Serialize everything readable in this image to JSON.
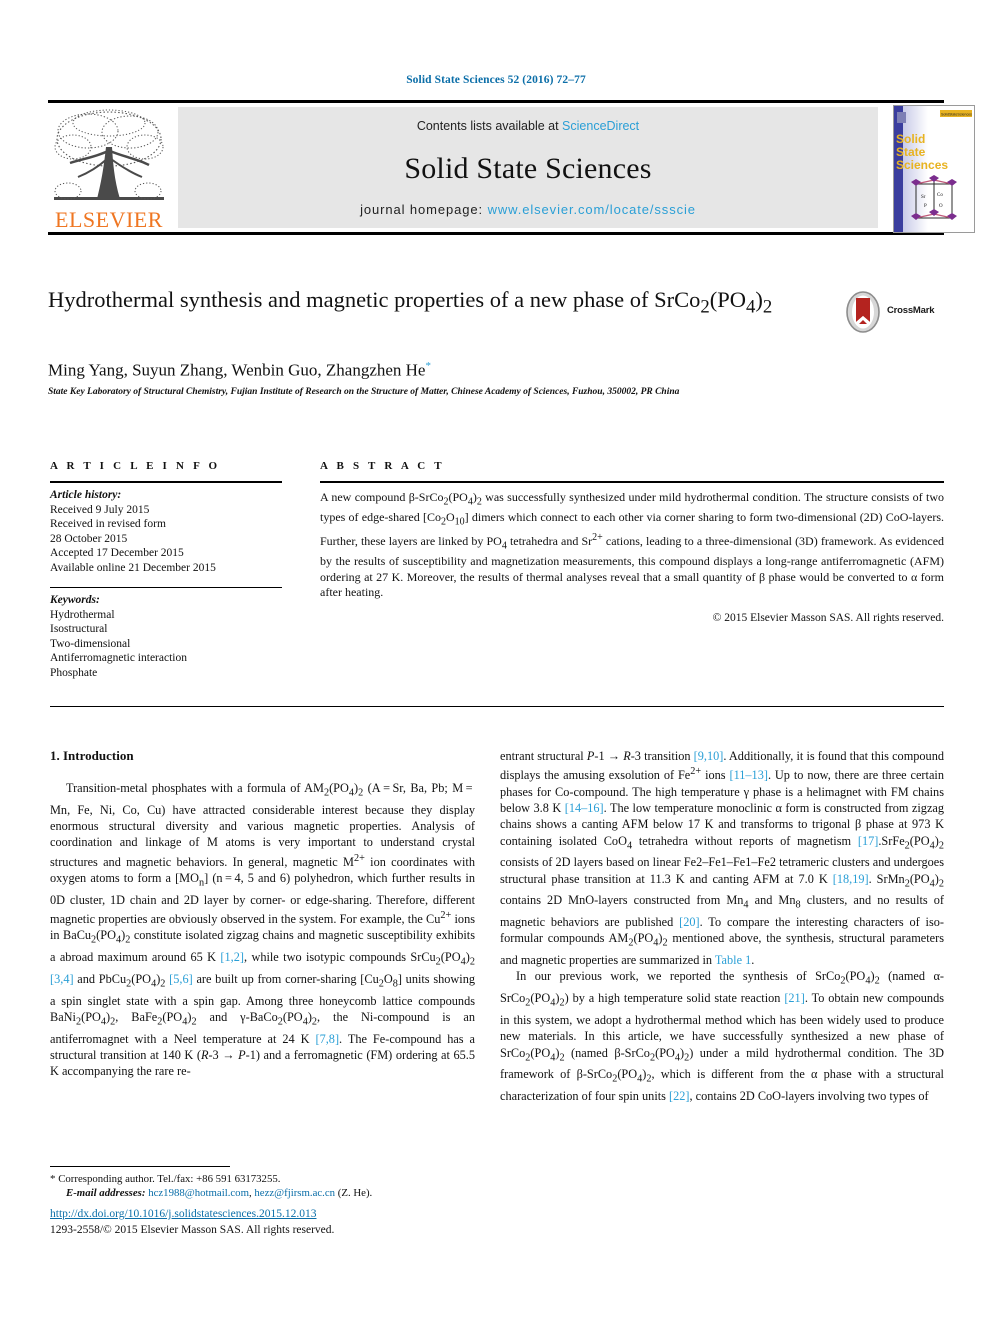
{
  "header": {
    "citation": "Solid State Sciences 52 (2016) 72–77",
    "contents_prefix": "Contents lists available at ",
    "contents_link": "ScienceDirect",
    "journal_name": "Solid State Sciences",
    "homepage_prefix": "journal homepage: ",
    "homepage_url": "www.elsevier.com/locate/ssscie",
    "publisher_wordmark": "ELSEVIER",
    "publisher_logo_icon": "elsevier-tree-icon",
    "cover_title_lines": [
      "Solid",
      "State",
      "Sciences"
    ],
    "cover_badge": "SolidStateSciences",
    "accent_link_color": "#2a9fd6",
    "citation_color": "#0b6ea8",
    "elsevier_orange": "#ef7622"
  },
  "article": {
    "title": "Hydrothermal synthesis and magnetic properties of a new phase of SrCo2(PO4)2",
    "authors": "Ming Yang, Suyun Zhang, Wenbin Guo, Zhangzhen He",
    "corresponding_marker": "*",
    "affiliation": "State Key Laboratory of Structural Chemistry, Fujian Institute of Research on the Structure of Matter, Chinese Academy of Sciences, Fuzhou, 350002, PR China",
    "crossmark_label": "CrossMark",
    "crossmark_icon": "crossmark-icon"
  },
  "article_info": {
    "heading": "A R T I C L E   I N F O",
    "history_label": "Article history:",
    "history_lines": [
      "Received 9 July 2015",
      "Received in revised form",
      "28 October 2015",
      "Accepted 17 December 2015",
      "Available online 21 December 2015"
    ],
    "keywords_label": "Keywords:",
    "keywords": [
      "Hydrothermal",
      "Isostructural",
      "Two-dimensional",
      "Antiferromagnetic interaction",
      "Phosphate"
    ]
  },
  "abstract": {
    "heading": "A B S T R A C T",
    "text": "A new compound β-SrCo2(PO4)2 was successfully synthesized under mild hydrothermal condition. The structure consists of two types of edge-shared [Co2O10] dimers which connect to each other via corner sharing to form two-dimensional (2D) CoO-layers. Further, these layers are linked by PO4 tetrahedra and Sr2+ cations, leading to a three-dimensional (3D) framework. As evidenced by the results of susceptibility and magnetization measurements, this compound displays a long-range antiferromagnetic (AFM) ordering at 27 K. Moreover, the results of thermal analyses reveal that a small quantity of β phase would be converted to α form after heating.",
    "copyright": "© 2015 Elsevier Masson SAS. All rights reserved."
  },
  "body": {
    "section_heading": "1. Introduction",
    "left_paragraph_1": "Transition-metal phosphates with a formula of AM2(PO4)2 (A = Sr, Ba, Pb; M = Mn, Fe, Ni, Co, Cu) have attracted considerable interest because they display enormous structural diversity and various magnetic properties. Analysis of coordination and linkage of M atoms is very important to understand crystal structures and magnetic behaviors. In general, magnetic M2+ ion coordinates with oxygen atoms to form a [MOn] (n = 4, 5 and 6) polyhedron, which further results in 0D cluster, 1D chain and 2D layer by corner- or edge-sharing. Therefore, different magnetic properties are obviously observed in the system. For example, the Cu2+ ions in BaCu2(PO4)2 constitute isolated zigzag chains and magnetic susceptibility exhibits a abroad maximum around 65 K [1,2], while two isotypic compounds SrCu2(PO4)2 [3,4] and PbCu2(PO4)2 [5,6] are built up from corner-sharing [Cu2O8] units showing a spin singlet state with a spin gap. Among three honeycomb lattice compounds BaNi2(PO4)2, BaFe2(PO4)2 and γ-BaCo2(PO4)2, the Ni-compound is an antiferromagnet with a Neel temperature at 24 K [7,8]. The Fe-compound has a structural transition at 140 K (R-3 → P-1) and a ferromagnetic (FM) ordering at 65.5 K accompanying the rare re-",
    "right_paragraph_1": "entrant structural P-1 → R-3 transition [9,10]. Additionally, it is found that this compound displays the amusing exsolution of Fe2+ ions [11–13]. Up to now, there are three certain phases for Co-compound. The high temperature γ phase is a helimagnet with FM chains below 3.8 K [14–16]. The low temperature monoclinic α form is constructed from zigzag chains shows a canting AFM below 17 K and transforms to trigonal β phase at 973 K containing isolated CoO4 tetrahedra without reports of magnetism [17].SrFe2(PO4)2 consists of 2D layers based on linear Fe2–Fe1–Fe1–Fe2 tetrameric clusters and undergoes structural phase transition at 11.3 K and canting AFM at 7.0 K [18,19]. SrMn2(PO4)2 contains 2D MnO-layers constructed from Mn4 and Mn8 clusters, and no results of magnetic behaviors are published [20]. To compare the interesting characters of iso-formular compounds AM2(PO4)2 mentioned above, the synthesis, structural parameters and magnetic properties are summarized in Table 1.",
    "right_paragraph_2": "In our previous work, we reported the synthesis of SrCo2(PO4)2 (named α-SrCo2(PO4)2) by a high temperature solid state reaction [21]. To obtain new compounds in this system, we adopt a hydrothermal method which has been widely used to produce new materials. In this article, we have successfully synthesized a new phase of SrCo2(PO4)2 (named β-SrCo2(PO4)2) under a mild hydrothermal condition. The 3D framework of β-SrCo2(PO4)2, which is different from the α phase with a structural characterization of four spin units [22], contains 2D CoO-layers involving two types of"
  },
  "footer": {
    "corresponding_note": "Corresponding author. Tel./fax: +86 591 63173255.",
    "email_label": "E-mail addresses:",
    "email_1": "hcz1988@hotmail.com",
    "email_2": "hezz@fjirsm.ac.cn",
    "email_suffix": "(Z. He).",
    "doi": "http://dx.doi.org/10.1016/j.solidstatesciences.2015.12.013",
    "issn_line": "1293-2558/© 2015 Elsevier Masson SAS. All rights reserved."
  }
}
